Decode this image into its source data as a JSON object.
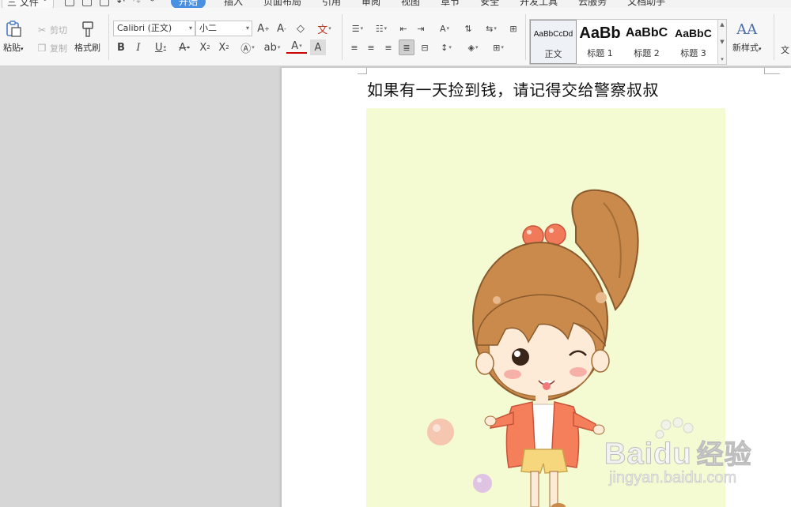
{
  "menubar": {
    "file_label": "三 文件",
    "tabs": [
      "开始",
      "插入",
      "页面布局",
      "引用",
      "审阅",
      "视图",
      "章节",
      "安全",
      "开发工具",
      "云服务",
      "文档助手"
    ],
    "active_tab": "开始"
  },
  "ribbon": {
    "clipboard": {
      "paste_label": "粘贴",
      "cut_label": "剪切",
      "copy_label": "复制",
      "format_painter_label": "格式刷"
    },
    "font": {
      "font_name": "Calibri (正文)",
      "font_size": "小二"
    },
    "styles": {
      "items": [
        {
          "sample": "AaBbCcDd",
          "label": "正文"
        },
        {
          "sample": "AaBb",
          "label": "标题 1"
        },
        {
          "sample": "AaBbC",
          "label": "标题 2"
        },
        {
          "sample": "AaBbC",
          "label": "标题 3"
        }
      ],
      "new_style_label": "新样式",
      "extra_label": "文"
    }
  },
  "document": {
    "heading": "如果有一天捡到钱，请记得交给警察叔叔",
    "picture_bg": "#f4fbd3"
  },
  "watermark": {
    "brand": "Bai",
    "brand2": "du",
    "cn": "经验",
    "url": "jingyan.baidu.com"
  },
  "colors": {
    "accent": "#4a90e2",
    "hair": "#c98a4b",
    "jacket": "#f47f5a",
    "shorts": "#f7d77d"
  }
}
